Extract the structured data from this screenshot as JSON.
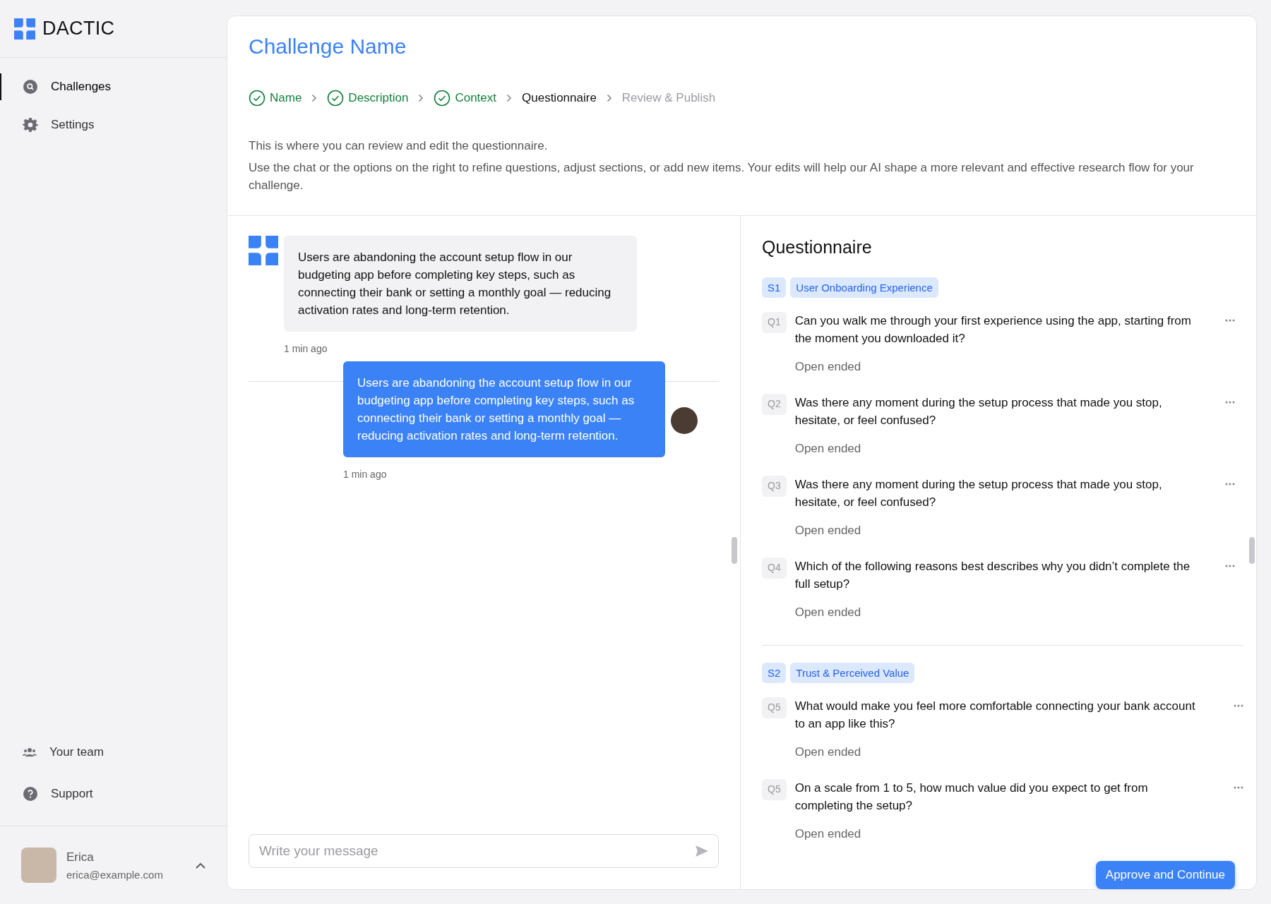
{
  "brand": {
    "name": "DACTIC"
  },
  "sidebar": {
    "items": [
      {
        "label": "Challenges",
        "selected": true
      },
      {
        "label": "Settings",
        "selected": false
      }
    ],
    "bottom_items": [
      {
        "label": "Your team"
      },
      {
        "label": "Support"
      }
    ],
    "user": {
      "name": "Erica",
      "email": "erica@example.com"
    }
  },
  "header": {
    "title": "Challenge Name",
    "steps": [
      {
        "label": "Name",
        "completed": true,
        "selected": false
      },
      {
        "label": "Description",
        "completed": true,
        "selected": false
      },
      {
        "label": "Context",
        "completed": true,
        "selected": false
      },
      {
        "label": "Questionnaire",
        "completed": false,
        "selected": true
      },
      {
        "label": "Review & Publish",
        "completed": false,
        "selected": false
      }
    ],
    "intro": "This is where you can review and edit the questionnaire.",
    "details": "Use the chat or the options on the right to refine questions, adjust sections, or add new items. Your edits will help our AI shape a more relevant and effective research flow for your challenge."
  },
  "chat": {
    "messages": [
      {
        "kind": "assistant",
        "text": "Users are abandoning the account setup flow in our budgeting app before completing key steps, such as connecting their bank or setting a monthly goal — reducing activation rates and long-term retention.",
        "time": "1 min ago"
      },
      {
        "kind": "user",
        "text": "Users are abandoning the account setup flow in our budgeting app before completing key steps, such as connecting their bank or setting a monthly goal — reducing activation rates and long-term retention.",
        "time": "1 min ago"
      }
    ],
    "input": {
      "placeholder": "Write your message"
    }
  },
  "questionnaire": {
    "title": "Questionnaire",
    "sections": [
      {
        "id": "S1",
        "title": "User Onboarding Experience",
        "questions": [
          {
            "number": "Q1",
            "text": "Can you walk me through your first experience using the app, starting from the moment you downloaded it?",
            "type": "Open ended"
          },
          {
            "number": "Q2",
            "text": "Was there any moment during the setup process that made you stop, hesitate, or feel confused?",
            "type": "Open ended"
          },
          {
            "number": "Q3",
            "text": "Was there any moment during the setup process that made you stop, hesitate, or feel confused?",
            "type": "Open ended"
          },
          {
            "number": "Q4",
            "text": "Which of the following reasons best describes why you didn’t complete the full setup?",
            "type": "Open ended"
          }
        ]
      },
      {
        "id": "S2",
        "title": "Trust & Perceived Value",
        "questions": [
          {
            "number": "Q5",
            "text": "What would make you feel more comfortable connecting your bank account to an app like this?",
            "type": "Open ended"
          },
          {
            "number": "Q5",
            "text": "On a scale from 1 to 5, how much value did you expect to get from completing the setup?",
            "type": "Open ended"
          }
        ]
      }
    ],
    "action": "Approve and Continue"
  }
}
